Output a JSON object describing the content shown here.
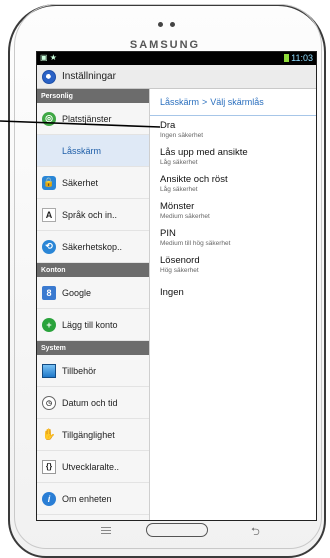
{
  "device": {
    "brand": "SAMSUNG"
  },
  "status": {
    "time": "11:03"
  },
  "actionbar": {
    "title": "Inställningar"
  },
  "sidebar": {
    "sections": [
      {
        "title": "Personlig",
        "items": [
          {
            "label": "Platstjänster",
            "icon": "location-icon",
            "glyph": "◎"
          },
          {
            "label": "Låsskärm",
            "icon": "lock-screen-icon",
            "glyph": "",
            "selected": true
          },
          {
            "label": "Säkerhet",
            "icon": "padlock-icon",
            "glyph": "🔒"
          },
          {
            "label": "Språk och in..",
            "icon": "language-icon",
            "glyph": "A"
          },
          {
            "label": "Säkerhetskop..",
            "icon": "backup-icon",
            "glyph": "⟲"
          }
        ]
      },
      {
        "title": "Konton",
        "items": [
          {
            "label": "Google",
            "icon": "google-icon",
            "glyph": "8"
          },
          {
            "label": "Lägg till konto",
            "icon": "add-account-icon",
            "glyph": "+"
          }
        ]
      },
      {
        "title": "System",
        "items": [
          {
            "label": "Tillbehör",
            "icon": "accessory-icon",
            "glyph": ""
          },
          {
            "label": "Datum och tid",
            "icon": "clock-icon",
            "glyph": "◷"
          },
          {
            "label": "Tillgänglighet",
            "icon": "accessibility-hand-icon",
            "glyph": "✋"
          },
          {
            "label": "Utvecklaralte..",
            "icon": "developer-braces-icon",
            "glyph": "{}"
          },
          {
            "label": "Om enheten",
            "icon": "info-icon",
            "glyph": "i"
          }
        ]
      }
    ]
  },
  "detail": {
    "breadcrumb": {
      "parent": "Låsskärm",
      "separator": ">",
      "current": "Välj skärmlås"
    },
    "options": [
      {
        "title": "Dra",
        "subtitle": "Ingen säkerhet"
      },
      {
        "title": "Lås upp med ansikte",
        "subtitle": "Låg säkerhet"
      },
      {
        "title": "Ansikte och röst",
        "subtitle": "Låg säkerhet"
      },
      {
        "title": "Mönster",
        "subtitle": "Medium säkerhet"
      },
      {
        "title": "PIN",
        "subtitle": "Medium till hög säkerhet"
      },
      {
        "title": "Lösenord",
        "subtitle": "Hög säkerhet"
      },
      {
        "title": "Ingen",
        "subtitle": ""
      }
    ]
  }
}
